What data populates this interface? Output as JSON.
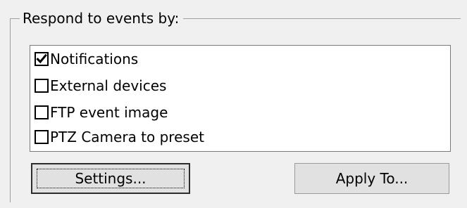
{
  "group": {
    "label": "Respond to events by:"
  },
  "events_list": {
    "items": [
      {
        "label": "Notifications",
        "checked": true
      },
      {
        "label": "External devices",
        "checked": false
      },
      {
        "label": "FTP event image",
        "checked": false
      },
      {
        "label": "PTZ Camera to preset",
        "checked": false
      }
    ]
  },
  "buttons": {
    "settings_label": "Settings...",
    "apply_to_label": "Apply To..."
  },
  "icons": {
    "check": "checkmark-icon"
  }
}
